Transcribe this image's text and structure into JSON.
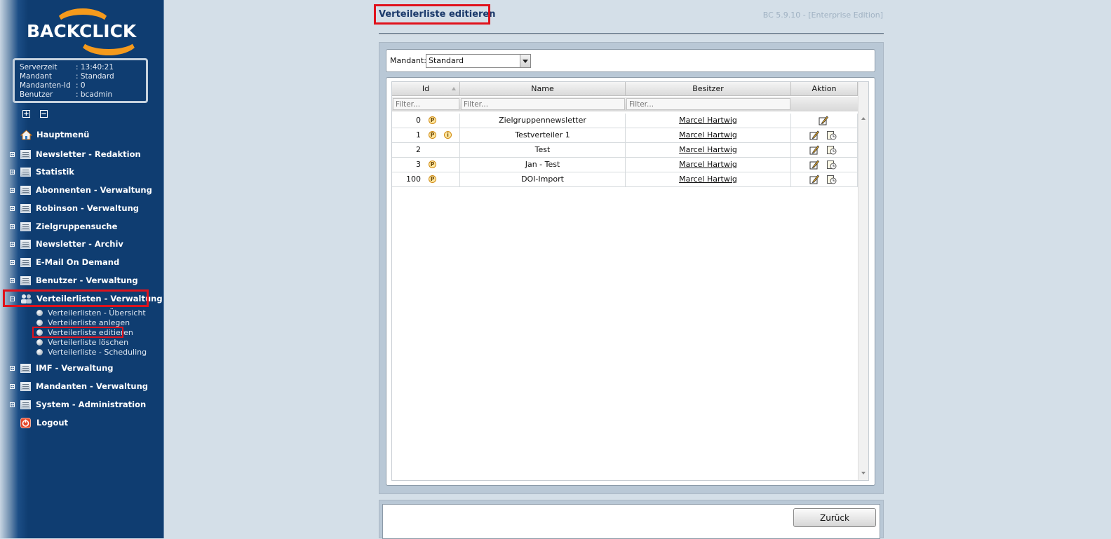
{
  "brand": {
    "logo_text": "BACKCLICK"
  },
  "info": [
    {
      "key": "Serverzeit",
      "value": ": 13:40:21"
    },
    {
      "key": "Mandant",
      "value": ": Standard"
    },
    {
      "key": "Mandanten-Id",
      "value": ": 0"
    },
    {
      "key": "Benutzer",
      "value": ": bcadmin"
    }
  ],
  "controls": {
    "expand": "+",
    "collapse": "−"
  },
  "menu": {
    "hauptmenu": "Hauptmenü",
    "newsletter_redaktion": "Newsletter - Redaktion",
    "statistik": "Statistik",
    "abonnenten": "Abonnenten - Verwaltung",
    "robinson": "Robinson - Verwaltung",
    "zielgruppensuche": "Zielgruppensuche",
    "newsletter_archiv": "Newsletter - Archiv",
    "email_on_demand": "E-Mail On Demand",
    "benutzer": "Benutzer - Verwaltung",
    "verteilerlisten": "Verteilerlisten - Verwaltung",
    "sub": [
      "Verteilerlisten - Übersicht",
      "Verteilerliste anlegen",
      "Verteilerliste editieren",
      "Verteilerliste löschen",
      "Verteilerliste - Scheduling"
    ],
    "imf": "IMF - Verwaltung",
    "mandanten": "Mandanten - Verwaltung",
    "system": "System - Administration",
    "logout": "Logout"
  },
  "page": {
    "title": "Verteilerliste editieren",
    "version": "BC 5.9.10 - [Enterprise Edition]"
  },
  "mandant": {
    "label": "Mandant:",
    "selected": "Standard"
  },
  "grid": {
    "columns": [
      "Id",
      "Name",
      "Besitzer",
      "Aktion"
    ],
    "filter_placeholder": "Filter...",
    "rows": [
      {
        "id": "0",
        "name": "Zielgruppennewsletter",
        "owner": "Marcel Hartwig"
      },
      {
        "id": "1",
        "name": "Testverteiler 1",
        "owner": "Marcel Hartwig"
      },
      {
        "id": "2",
        "name": "Test",
        "owner": "Marcel Hartwig"
      },
      {
        "id": "3",
        "name": "Jan - Test",
        "owner": "Marcel Hartwig"
      },
      {
        "id": "100",
        "name": "DOI-Import",
        "owner": "Marcel Hartwig"
      }
    ],
    "badge_p": "P",
    "badge_i": "i"
  },
  "footer": {
    "back_label": "Zurück"
  },
  "colors": {
    "sidebar": "#0f3d71",
    "highlight": "#e0121c",
    "logo_orange": "#f59a1c"
  }
}
